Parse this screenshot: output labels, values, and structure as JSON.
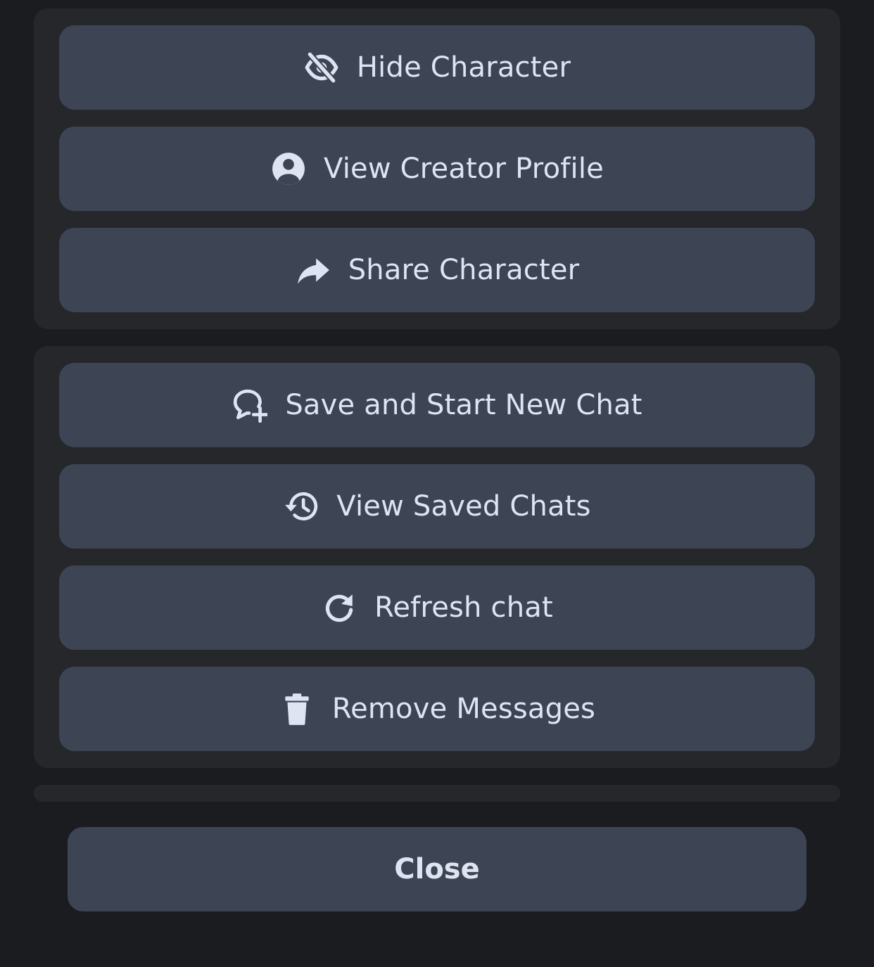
{
  "colors": {
    "background": "#1b1c1f",
    "group_background": "#25272b",
    "button_background": "#3d4554",
    "text": "#dfe4f2"
  },
  "character_actions": [
    {
      "label": "Hide Character",
      "icon": "eye-slash-icon"
    },
    {
      "label": "View Creator Profile",
      "icon": "user-circle-icon"
    },
    {
      "label": "Share Character",
      "icon": "share-arrow-icon"
    }
  ],
  "chat_actions": [
    {
      "label": "Save and Start New Chat",
      "icon": "chat-plus-icon"
    },
    {
      "label": "View Saved Chats",
      "icon": "history-icon"
    },
    {
      "label": "Refresh chat",
      "icon": "refresh-icon"
    },
    {
      "label": "Remove Messages",
      "icon": "trash-icon"
    }
  ],
  "close_label": "Close"
}
